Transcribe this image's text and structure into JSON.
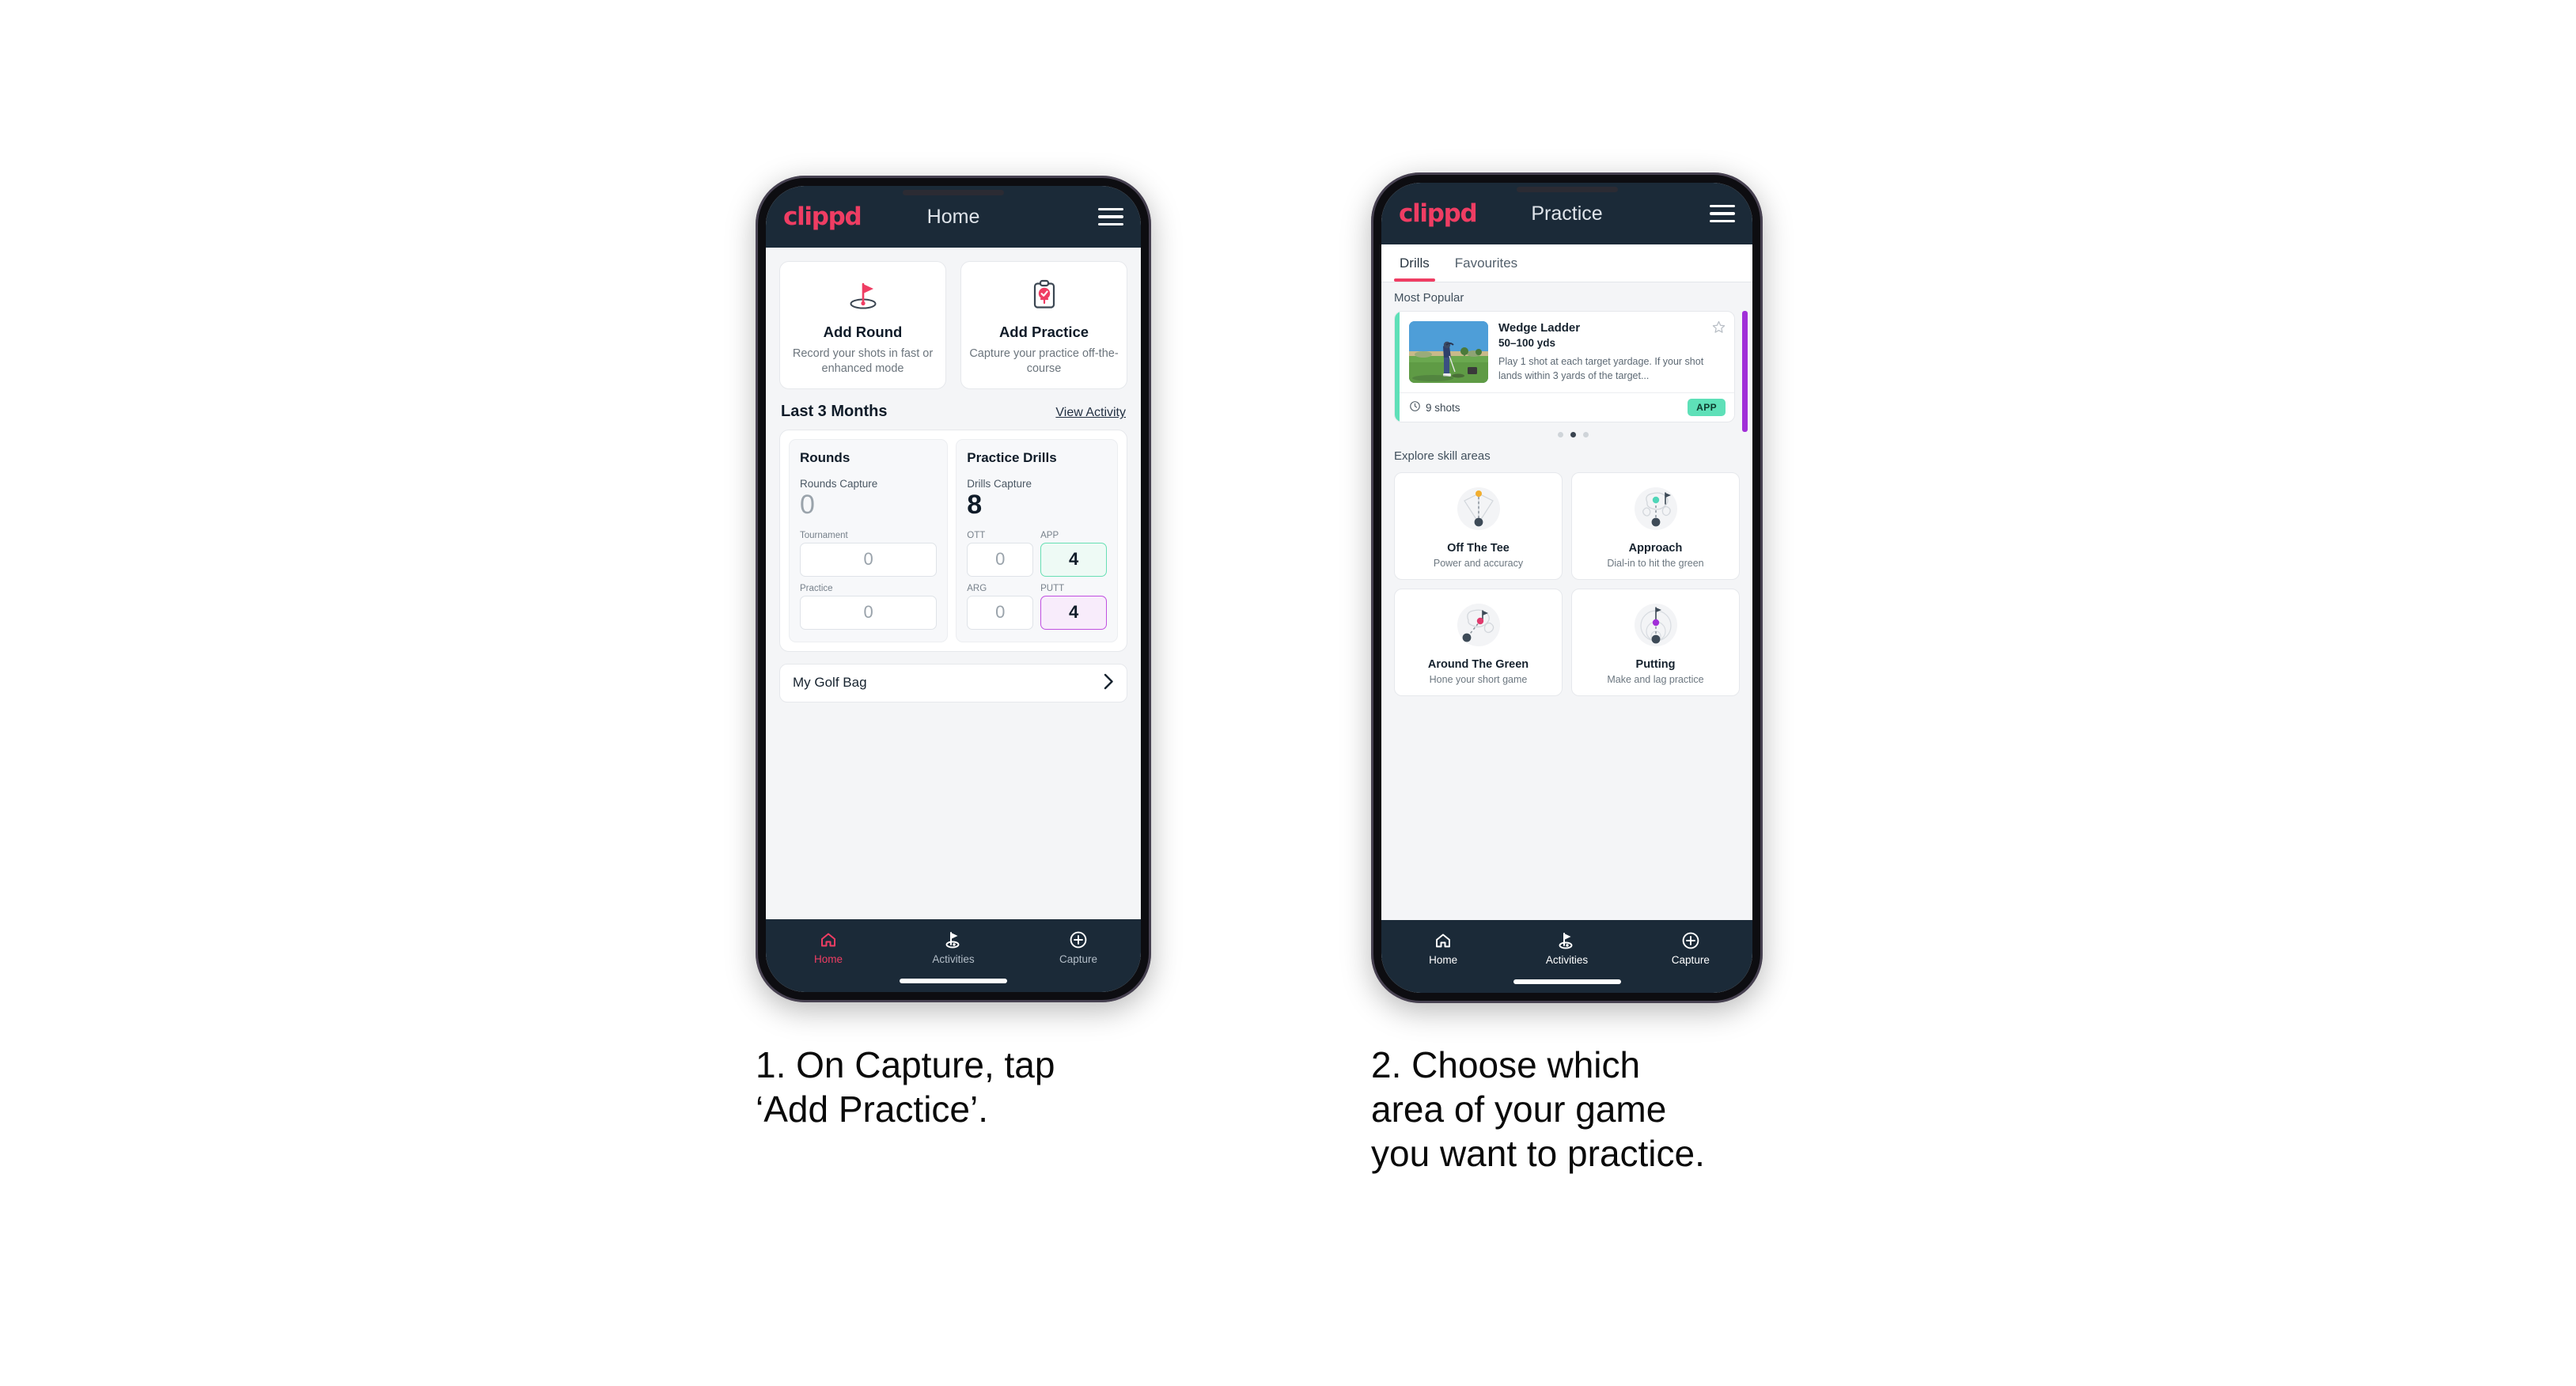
{
  "brand": {
    "logo_text": "clippd",
    "accent_pink": "#ef3d63",
    "header_navy": "#1b2a38",
    "mint": "#5ee0b8",
    "purple": "#a12fd8"
  },
  "phone1": {
    "header": {
      "title": "Home",
      "menu_icon": "hamburger-menu-icon"
    },
    "quick_actions": [
      {
        "icon": "golf-flag-hole-icon",
        "title": "Add Round",
        "subtitle": "Record your shots in fast or enhanced mode"
      },
      {
        "icon": "clipboard-check-icon",
        "title": "Add Practice",
        "subtitle": "Capture your practice off-the-course"
      }
    ],
    "section": {
      "title": "Last 3 Months",
      "link": "View Activity"
    },
    "rounds": {
      "heading": "Rounds",
      "capture_label": "Rounds Capture",
      "capture_value": "0",
      "metrics": [
        {
          "label": "Tournament",
          "value": "0",
          "state": "empty"
        },
        {
          "label": "Practice",
          "value": "0",
          "state": "empty"
        }
      ]
    },
    "drills": {
      "heading": "Practice Drills",
      "capture_label": "Drills Capture",
      "capture_value": "8",
      "metrics": [
        {
          "label": "OTT",
          "value": "0",
          "state": "empty"
        },
        {
          "label": "APP",
          "value": "4",
          "state": "green"
        },
        {
          "label": "ARG",
          "value": "0",
          "state": "empty"
        },
        {
          "label": "PUTT",
          "value": "4",
          "state": "purple"
        }
      ]
    },
    "golf_bag": {
      "label": "My Golf Bag",
      "chevron": "chevron-right-icon"
    },
    "nav": [
      {
        "label": "Home",
        "icon": "home-icon",
        "active": true
      },
      {
        "label": "Activities",
        "icon": "golf-flag-icon",
        "active": false
      },
      {
        "label": "Capture",
        "icon": "plus-circle-icon",
        "active": false
      }
    ],
    "caption": "1. On Capture, tap\n‘Add Practice’."
  },
  "phone2": {
    "header": {
      "title": "Practice",
      "menu_icon": "hamburger-menu-icon"
    },
    "tabs": [
      {
        "label": "Drills",
        "selected": true
      },
      {
        "label": "Favourites",
        "selected": false
      }
    ],
    "most_popular": {
      "heading": "Most Popular",
      "drill": {
        "name": "Wedge Ladder",
        "yardage": "50–100 yds",
        "description": "Play 1 shot at each target yardage. If your shot lands within 3 yards of the target...",
        "shots": "9 shots",
        "shots_icon": "clock-icon",
        "badge": "APP",
        "favourite_icon": "star-outline-icon",
        "accent": "#5ee0b8"
      },
      "dots": {
        "count": 3,
        "active_index": 1
      }
    },
    "explore": {
      "heading": "Explore skill areas",
      "areas": [
        {
          "icon": "off-the-tee-icon",
          "title": "Off The Tee",
          "subtitle": "Power and accuracy"
        },
        {
          "icon": "approach-icon",
          "title": "Approach",
          "subtitle": "Dial-in to hit the green"
        },
        {
          "icon": "around-the-green-icon",
          "title": "Around The Green",
          "subtitle": "Hone your short game"
        },
        {
          "icon": "putting-icon",
          "title": "Putting",
          "subtitle": "Make and lag practice"
        }
      ]
    },
    "nav": [
      {
        "label": "Home",
        "icon": "home-icon",
        "active": false
      },
      {
        "label": "Activities",
        "icon": "golf-flag-icon",
        "active": false
      },
      {
        "label": "Capture",
        "icon": "plus-circle-icon",
        "active": false
      }
    ],
    "caption": "2. Choose which\narea of your game\nyou want to practice."
  }
}
